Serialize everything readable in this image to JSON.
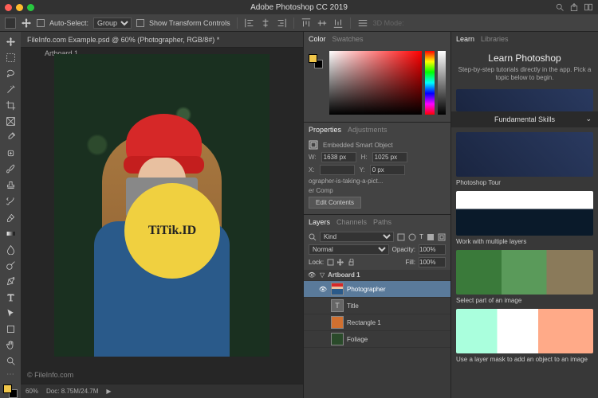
{
  "app": {
    "title": "Adobe Photoshop CC 2019"
  },
  "optionbar": {
    "auto_select": "Auto-Select:",
    "group": "Group",
    "show_transform": "Show Transform Controls",
    "mode_3d": "3D Mode:"
  },
  "document": {
    "tab": "FileInfo.com Example.psd @ 60% (Photographer, RGB/8#) *",
    "artboard": "Artboard 1",
    "credit": "© FileInfo.com",
    "badge": "TiTik.ID"
  },
  "status": {
    "zoom": "60%",
    "doc": "Doc: 8.75M/24.7M"
  },
  "panels": {
    "color": {
      "tab1": "Color",
      "tab2": "Swatches"
    },
    "properties": {
      "tab1": "Properties",
      "tab2": "Adjustments",
      "type": "Embedded Smart Object",
      "w_label": "W:",
      "w": "1638 px",
      "h_label": "H:",
      "h": "1025 px",
      "x_label": "X:",
      "x": "",
      "y_label": "Y:",
      "y": "0 px",
      "filename": "ographer-is-taking-a-pict...",
      "layercomp": "er Comp",
      "edit_btn": "Edit Contents"
    },
    "layers": {
      "tab1": "Layers",
      "tab2": "Channels",
      "tab3": "Paths",
      "kind": "Kind",
      "blend": "Normal",
      "opacity_lbl": "Opacity:",
      "opacity": "100%",
      "lock": "Lock:",
      "fill_lbl": "Fill:",
      "fill": "100%",
      "items": [
        {
          "name": "Artboard 1",
          "artboard": true
        },
        {
          "name": "Photographer",
          "sel": true
        },
        {
          "name": "Title",
          "type": "T"
        },
        {
          "name": "Rectangle 1",
          "type": "R"
        },
        {
          "name": "Foliage"
        }
      ]
    }
  },
  "learn": {
    "tab1": "Learn",
    "tab2": "Libraries",
    "title": "Learn Photoshop",
    "subtitle": "Step-by-step tutorials directly in the app. Pick a topic below to begin.",
    "section": "Fundamental Skills",
    "tutorials": [
      "Photoshop Tour",
      "Work with multiple layers",
      "Select part of an image",
      "Use a layer mask to add an object to an image"
    ]
  }
}
